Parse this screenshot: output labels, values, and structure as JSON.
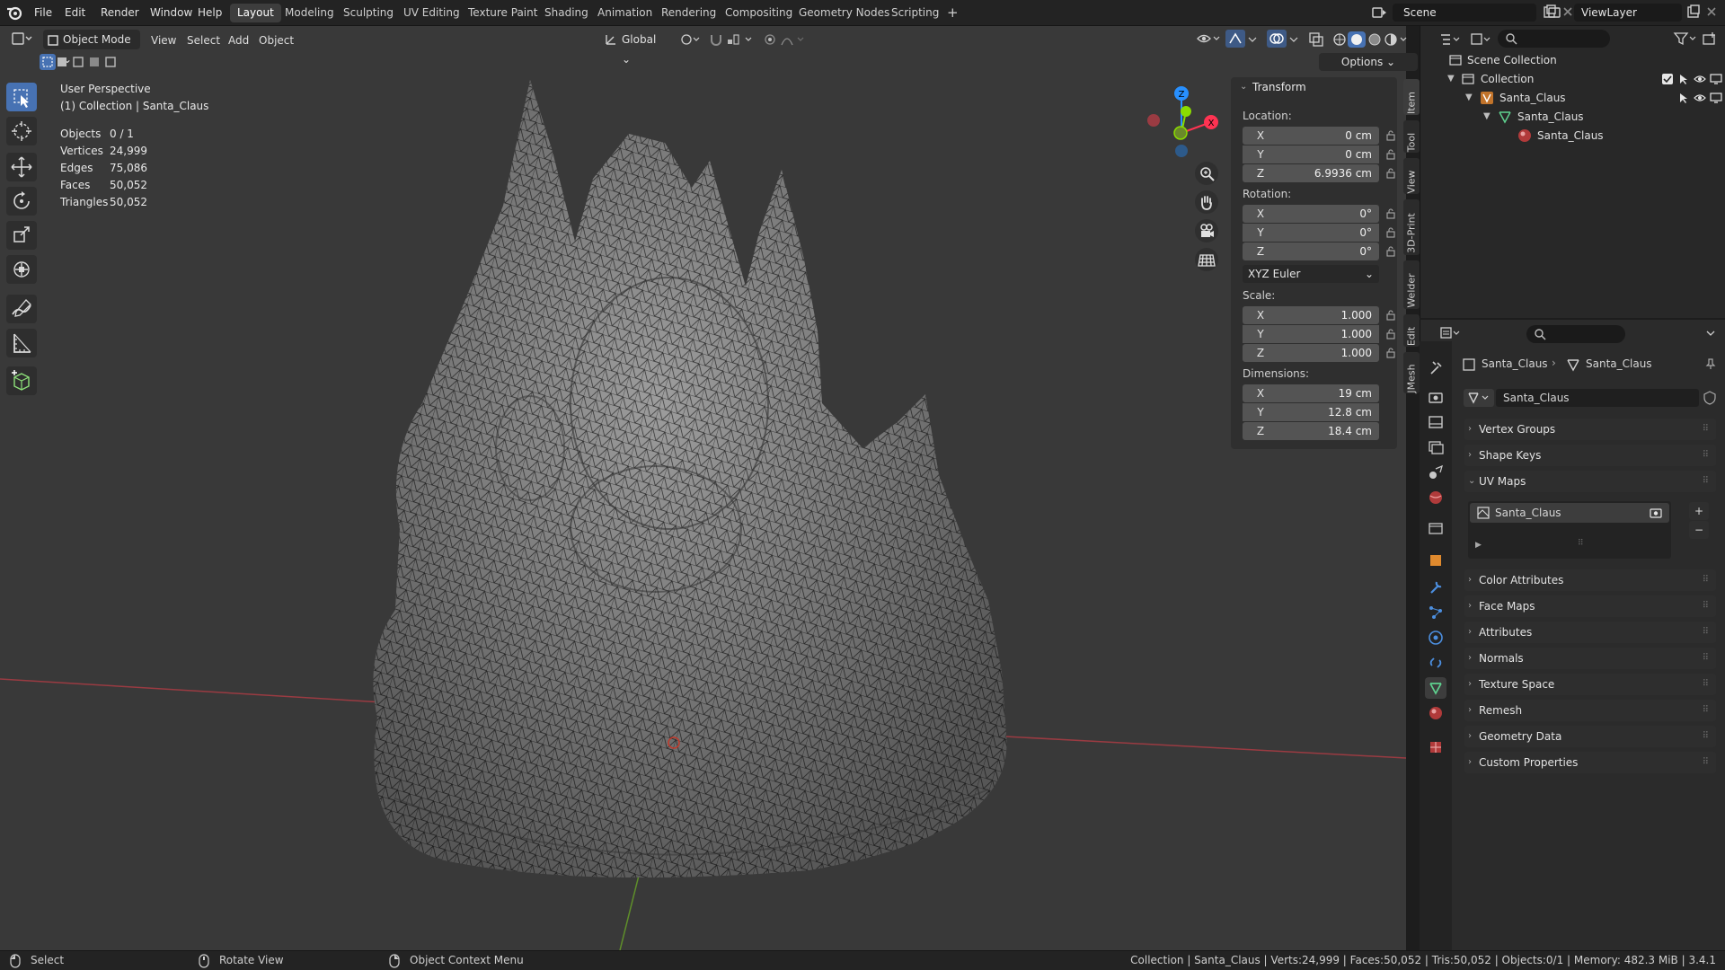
{
  "menu": {
    "file": "File",
    "edit": "Edit",
    "render": "Render",
    "window": "Window",
    "help": "Help"
  },
  "workspaces": [
    "Layout",
    "Modeling",
    "Sculpting",
    "UV Editing",
    "Texture Paint",
    "Shading",
    "Animation",
    "Rendering",
    "Compositing",
    "Geometry Nodes",
    "Scripting"
  ],
  "active_workspace": "Layout",
  "scene": {
    "name": "Scene"
  },
  "view_layer": {
    "name": "ViewLayer"
  },
  "viewport_header": {
    "mode": "Object Mode",
    "view": "View",
    "select": "Select",
    "add": "Add",
    "object": "Object",
    "orientation": "Global",
    "options": "Options"
  },
  "overlay": {
    "perspective": "User Perspective",
    "collection": "(1) Collection | Santa_Claus",
    "stats": [
      {
        "label": "Objects",
        "value": "0 / 1"
      },
      {
        "label": "Vertices",
        "value": "24,999"
      },
      {
        "label": "Edges",
        "value": "75,086"
      },
      {
        "label": "Faces",
        "value": "50,052"
      },
      {
        "label": "Triangles",
        "value": "50,052"
      }
    ]
  },
  "transform": {
    "title": "Transform",
    "location_label": "Location:",
    "location": [
      {
        "axis": "X",
        "value": "0 cm"
      },
      {
        "axis": "Y",
        "value": "0 cm"
      },
      {
        "axis": "Z",
        "value": "6.9936 cm"
      }
    ],
    "rotation_label": "Rotation:",
    "rotation": [
      {
        "axis": "X",
        "value": "0°"
      },
      {
        "axis": "Y",
        "value": "0°"
      },
      {
        "axis": "Z",
        "value": "0°"
      }
    ],
    "rotation_mode": "XYZ Euler",
    "scale_label": "Scale:",
    "scale": [
      {
        "axis": "X",
        "value": "1.000"
      },
      {
        "axis": "Y",
        "value": "1.000"
      },
      {
        "axis": "Z",
        "value": "1.000"
      }
    ],
    "dimensions_label": "Dimensions:",
    "dimensions": [
      {
        "axis": "X",
        "value": "19 cm"
      },
      {
        "axis": "Y",
        "value": "12.8 cm"
      },
      {
        "axis": "Z",
        "value": "18.4 cm"
      }
    ]
  },
  "sidebar_tabs": [
    "Item",
    "Tool",
    "View",
    "3D-Print",
    "Welder",
    "Edit",
    "JMesh"
  ],
  "outliner": {
    "scene_collection": "Scene Collection",
    "collection": "Collection",
    "object": "Santa_Claus",
    "mesh": "Santa_Claus",
    "material": "Santa_Claus"
  },
  "properties": {
    "breadcrumb_object": "Santa_Claus",
    "breadcrumb_mesh": "Santa_Claus",
    "mesh_name": "Santa_Claus",
    "panels_top": [
      "Vertex Groups",
      "Shape Keys"
    ],
    "uv_maps_title": "UV Maps",
    "uv_map_item": "Santa_Claus",
    "panels_bottom": [
      "Color Attributes",
      "Face Maps",
      "Attributes",
      "Normals",
      "Texture Space",
      "Remesh",
      "Geometry Data",
      "Custom Properties"
    ]
  },
  "statusbar": {
    "select": "Select",
    "rotate": "Rotate View",
    "context": "Object Context Menu",
    "info": "Collection | Santa_Claus | Verts:24,999 | Faces:50,052 | Tris:50,052 | Objects:0/1 | Memory: 482.3 MiB | 3.4.1"
  },
  "colors": {
    "accent": "#4772b3",
    "x_axis": "#ff3352",
    "y_axis": "#8bdc00",
    "z_axis": "#2890ff"
  },
  "icons": [
    "blender-logo",
    "select-box-icon",
    "cursor-icon",
    "move-icon",
    "rotate-icon",
    "scale-icon",
    "transform-icon",
    "annotate-icon",
    "measure-icon",
    "add-cube-icon",
    "zoom-icon",
    "hand-icon",
    "camera-icon",
    "grid-icon",
    "lock-icon",
    "eye-icon",
    "camera-render-icon",
    "filter-icon",
    "search-icon"
  ]
}
